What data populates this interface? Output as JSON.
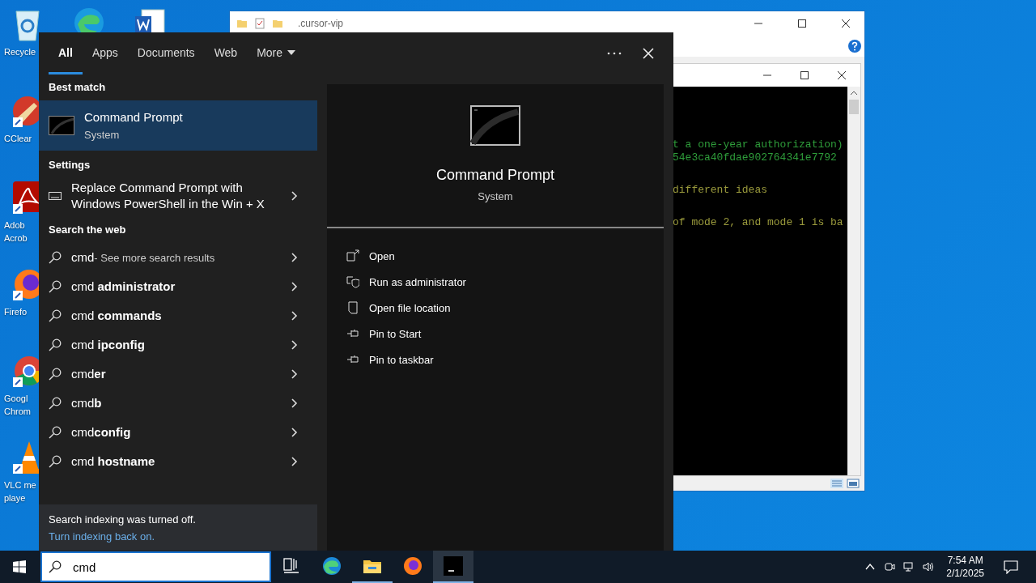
{
  "desktop": {
    "top_icons": [
      {
        "kind": "edge"
      },
      {
        "kind": "word"
      }
    ],
    "icons": [
      {
        "kind": "recycle",
        "lines": [
          "Recycle"
        ]
      },
      {
        "kind": "ccleaner",
        "lines": [
          "CClear"
        ]
      },
      {
        "kind": "acrobat",
        "lines": [
          "Adob",
          "Acrob"
        ]
      },
      {
        "kind": "firefox",
        "lines": [
          "Firefo"
        ]
      },
      {
        "kind": "chrome",
        "lines": [
          "Googl",
          "Chrom"
        ]
      },
      {
        "kind": "vlc",
        "lines": [
          "VLC me",
          "playe"
        ]
      }
    ]
  },
  "explorer": {
    "title": ".cursor-vip"
  },
  "console": {
    "blocks": [
      {
        "color": "#2e9c3a",
        "lines": [
          "t a one-year authorization)",
          "54e3ca40fdae902764341e7792"
        ]
      },
      {
        "color": "#9a9a3c",
        "lines": [
          "different ideas"
        ]
      },
      {
        "color": "#9a9a3c",
        "lines": [
          "of mode 2, and mode 1 is ba"
        ]
      }
    ]
  },
  "search_panel": {
    "tabs": [
      {
        "label": "All",
        "selected": true
      },
      {
        "label": "Apps",
        "selected": false
      },
      {
        "label": "Documents",
        "selected": false
      },
      {
        "label": "Web",
        "selected": false
      },
      {
        "label": "More",
        "selected": false
      }
    ],
    "sections": [
      {
        "heading": "Best match",
        "items": [
          {
            "kind": "app",
            "title": "Command Prompt",
            "subtitle": "System",
            "selected": true
          }
        ]
      },
      {
        "heading": "Settings",
        "items": [
          {
            "kind": "setting",
            "text": "Replace Command Prompt with Windows PowerShell in the Win + X",
            "selected": false
          }
        ]
      },
      {
        "heading": "Search the web",
        "items": [
          {
            "kind": "web",
            "text": "cmd",
            "note": "- See more search results",
            "selected": false
          },
          {
            "kind": "web",
            "text": "cmd **administrator**",
            "selected": false
          },
          {
            "kind": "web",
            "text": "cmd **commands**",
            "selected": false
          },
          {
            "kind": "web",
            "text": "cmd **ipconfig**",
            "selected": false
          },
          {
            "kind": "web",
            "text": "cmd**er**",
            "selected": false
          },
          {
            "kind": "web",
            "text": "cmd**b**",
            "selected": false
          },
          {
            "kind": "web",
            "text": "cmd**config**",
            "selected": false
          },
          {
            "kind": "web",
            "text": "cmd **hostname**",
            "selected": false
          }
        ]
      }
    ],
    "footer": {
      "message": "Search indexing was turned off.",
      "link": "Turn indexing back on."
    },
    "preview": {
      "title": "Command Prompt",
      "subtitle": "System",
      "actions": [
        {
          "kind": "open",
          "label": "Open"
        },
        {
          "kind": "admin",
          "label": "Run as administrator"
        },
        {
          "kind": "folder",
          "label": "Open file location"
        },
        {
          "kind": "pin",
          "label": "Pin to Start"
        },
        {
          "kind": "pin",
          "label": "Pin to taskbar"
        }
      ]
    }
  },
  "taskbar": {
    "search": {
      "value": "cmd"
    },
    "apps": [
      {
        "kind": "task_view",
        "running": false,
        "selected": false
      },
      {
        "kind": "edge",
        "running": false,
        "selected": false
      },
      {
        "kind": "explorer",
        "running": true,
        "selected": false
      },
      {
        "kind": "firefox",
        "running": false,
        "selected": false
      },
      {
        "kind": "terminal",
        "running": true,
        "selected": true
      }
    ],
    "clock": {
      "time": "7:54 AM",
      "date": "2/1/2025"
    }
  }
}
